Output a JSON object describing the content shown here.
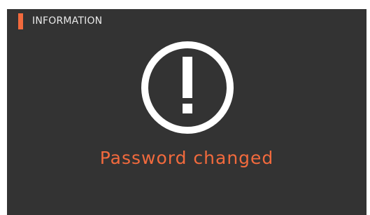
{
  "dialog": {
    "title": "INFORMATION",
    "message": "Password changed",
    "icon": "exclamation-circle-icon"
  },
  "colors": {
    "panel_background": "#333333",
    "accent": "#f26a3d",
    "icon_white": "#ffffff",
    "title_text": "#e9e9e9"
  }
}
